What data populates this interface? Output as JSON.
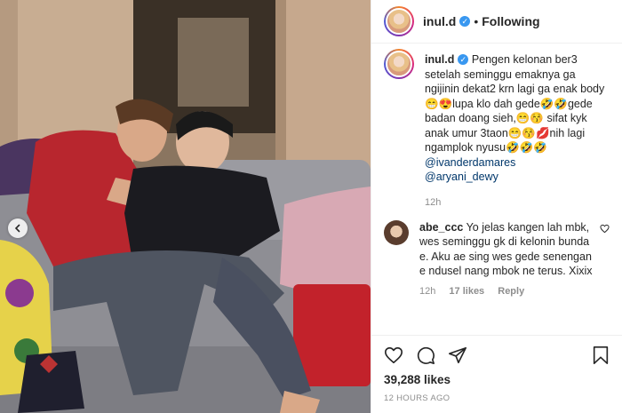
{
  "post": {
    "username": "inul.d",
    "follow_status": "Following",
    "separator": "•",
    "caption": {
      "username": "inul.d",
      "text": "Pengen kelonan ber3 setelah seminggu emaknya ga ngijinin dekat2 krn lagi ga enak body😁😍lupa klo dah gede🤣🤣gede badan doang sieh,😁😚 sifat kyk anak umur 3taon😁😚💋nih lagi ngamplok nyusu🤣🤣🤣",
      "mentions": [
        "@ivanderdamares",
        "@aryani_dewy"
      ],
      "age": "12h"
    },
    "comments": [
      {
        "username": "abe_ccc",
        "text": "Yo jelas kangen lah mbk, wes seminggu gk di kelonin bunda e. Aku ae sing wes gede senengan e ndusel nang mbok ne terus. Xixix",
        "age": "12h",
        "likes": "17 likes",
        "reply_label": "Reply"
      }
    ],
    "likes_count": "39,288 likes",
    "posted_ago": "12 HOURS AGO"
  },
  "colors": {
    "accent_blue": "#3897f0",
    "mention": "#00376b",
    "muted": "#8e8e8e"
  },
  "icons": [
    "verified-icon",
    "heart-icon",
    "comment-icon",
    "share-icon",
    "bookmark-icon",
    "carousel-prev-icon"
  ]
}
